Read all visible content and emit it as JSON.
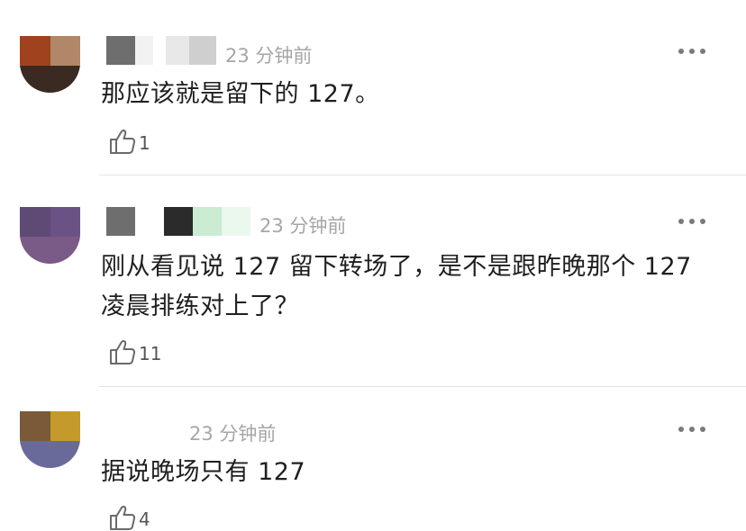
{
  "comments": [
    {
      "time": "23 分钟前",
      "text": "那应该就是留下的 127。",
      "likes": "1",
      "avatar_colors": [
        "#a0421e",
        "#b08867",
        "#3a2a22"
      ]
    },
    {
      "time": "23 分钟前",
      "text": "刚从看见说 127 留下转场了，是不是跟昨晚那个 127 凌晨排练对上了？",
      "likes": "11",
      "avatar_colors": [
        "#5e4a75",
        "#6b5284",
        "#7a5a86"
      ]
    },
    {
      "time": "23 分钟前",
      "text": "据说晚场只有 127",
      "likes": "4",
      "avatar_colors": [
        "#7a5a38",
        "#c49a2c",
        "#6a6a9a"
      ]
    }
  ],
  "icons": {
    "like": "thumbs-up-icon",
    "more": "more-dots-icon"
  }
}
